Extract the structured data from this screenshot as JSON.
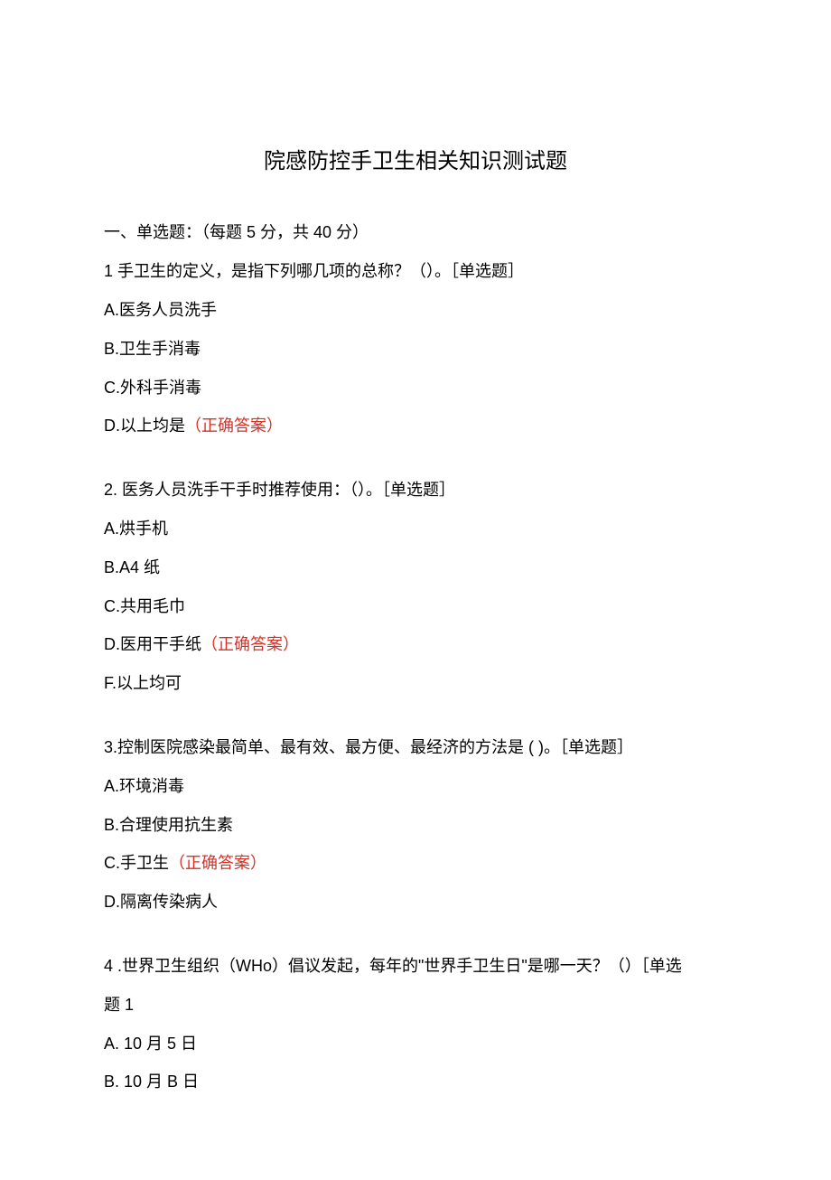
{
  "title": "院感防控手卫生相关知识测试题",
  "section_header": "一、单选题：（每题 5 分，共 40 分）",
  "correct_label": "（正确答案）",
  "q1": {
    "text": "1 手卫生的定义，是指下列哪几项的总称？（）。［单选题］",
    "a": "A.医务人员洗手",
    "b": "B.卫生手消毒",
    "c": "C.外科手消毒",
    "d": "D.以上均是"
  },
  "q2": {
    "text": "2. 医务人员洗手干手时推荐使用：（）。［单选题］",
    "a": "A.烘手机",
    "b": "B.A4 纸",
    "c": "C.共用毛巾",
    "d": "D.医用干手纸",
    "f": "F.以上均可"
  },
  "q3": {
    "text": "3.控制医院感染最简单、最有效、最方便、最经济的方法是 ( )。［单选题］",
    "a": "A.环境消毒",
    "b": "B.合理使用抗生素",
    "c": "C.手卫生",
    "d": "D.隔离传染病人"
  },
  "q4": {
    "text_l1": "4  .世界卫生组织（WHo）倡议发起，每年的\"世界手卫生日\"是哪一天？（）［单选",
    "text_l2": "题 1",
    "a": "A.   10 月 5 日",
    "b": "B.   10 月 B 日"
  }
}
